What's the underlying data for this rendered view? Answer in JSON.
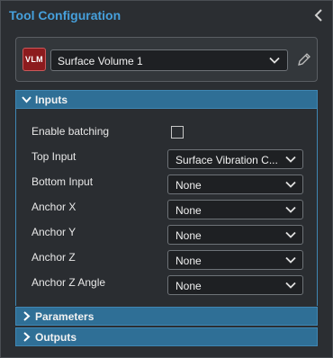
{
  "panel": {
    "title": "Tool Configuration"
  },
  "tool": {
    "badge": "VLM",
    "selected": "Surface Volume 1"
  },
  "sections": {
    "inputs": "Inputs",
    "parameters": "Parameters",
    "outputs": "Outputs"
  },
  "inputs": {
    "enable_batching": {
      "label": "Enable batching",
      "checked": false
    },
    "top_input": {
      "label": "Top Input",
      "value": "Surface Vibration C..."
    },
    "bottom_input": {
      "label": "Bottom Input",
      "value": "None"
    },
    "anchor_x": {
      "label": "Anchor X",
      "value": "None"
    },
    "anchor_y": {
      "label": "Anchor Y",
      "value": "None"
    },
    "anchor_z": {
      "label": "Anchor Z",
      "value": "None"
    },
    "anchor_z_angle": {
      "label": "Anchor Z Angle",
      "value": "None"
    }
  },
  "icons": {
    "collapse": "chevron-left-icon",
    "edit": "pencil-icon",
    "dropdown": "chevron-down-icon",
    "expanded": "chevron-down-icon",
    "collapsed": "chevron-right-icon"
  },
  "colors": {
    "title": "#46a0dc",
    "section_header": "#2f6f96",
    "badge": "#8c1b1e"
  }
}
